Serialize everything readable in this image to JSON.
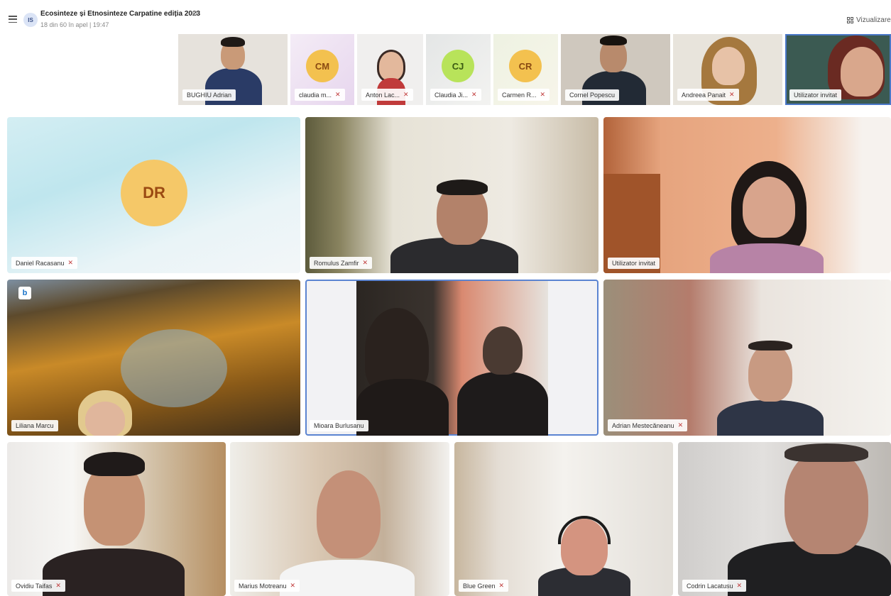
{
  "header": {
    "avatar_initials": "IS",
    "title": "Ecosinteze și Etnosinteze Carpatine ediția 2023",
    "subtitle": "18 din 60 în apel | 19:47",
    "view_label": "Vizualizare"
  },
  "thumbnails": [
    {
      "name": "BUGHIU Adrian",
      "muted": false
    },
    {
      "name": "claudia m...",
      "initials": "CM",
      "muted": true
    },
    {
      "name": "Anton Lac...",
      "muted": true
    },
    {
      "name": "Claudia Ji...",
      "initials": "CJ",
      "muted": true
    },
    {
      "name": "Carmen R...",
      "initials": "CR",
      "muted": true
    },
    {
      "name": "Cornel Popescu",
      "muted": false
    },
    {
      "name": "Andreea Panait",
      "muted": true
    },
    {
      "name": "Utilizator invitat",
      "muted": false
    }
  ],
  "tiles": [
    {
      "name": "Daniel Racasanu",
      "initials": "DR",
      "muted": true
    },
    {
      "name": "Romulus Zamfir",
      "muted": true
    },
    {
      "name": "Utilizator invitat",
      "muted": false
    },
    {
      "name": "Liliana Marcu",
      "muted": false,
      "badge": "b"
    },
    {
      "name": "Mioara Burlusanu",
      "muted": false
    },
    {
      "name": "Adrian Mestecăneanu",
      "muted": true
    },
    {
      "name": "Ovidiu Taifas",
      "muted": true
    },
    {
      "name": "Marius Motreanu",
      "muted": true
    },
    {
      "name": "Blue Green",
      "muted": true
    },
    {
      "name": "Codrin Lacatusu",
      "muted": true
    }
  ],
  "icons": {
    "mute": "🎙",
    "menu": "menu-icon",
    "settings": "gear-icon",
    "view": "grid-icon"
  }
}
